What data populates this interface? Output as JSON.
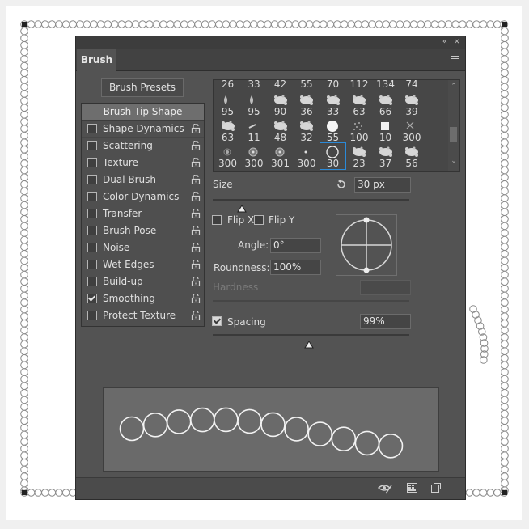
{
  "panel": {
    "collapse_icon": "double-chevron-left-icon",
    "close_icon": "close-icon",
    "tab_label": "Brush",
    "menu_icon": "panel-menu-icon"
  },
  "presets_button": "Brush Presets",
  "tip_shape_header": "Brush Tip Shape",
  "settings": [
    {
      "label": "Shape Dynamics",
      "checked": false
    },
    {
      "label": "Scattering",
      "checked": false
    },
    {
      "label": "Texture",
      "checked": false
    },
    {
      "label": "Dual Brush",
      "checked": false
    },
    {
      "label": "Color Dynamics",
      "checked": false
    },
    {
      "label": "Transfer",
      "checked": false
    },
    {
      "label": "Brush Pose",
      "checked": false
    },
    {
      "label": "Noise",
      "checked": false
    },
    {
      "label": "Wet Edges",
      "checked": false
    },
    {
      "label": "Build-up",
      "checked": false
    },
    {
      "label": "Smoothing",
      "checked": true
    },
    {
      "label": "Protect Texture",
      "checked": false
    }
  ],
  "tip_grid": {
    "top_row": [
      "26",
      "33",
      "42",
      "55",
      "70",
      "112",
      "134",
      "74"
    ],
    "rows": [
      [
        "95",
        "95",
        "90",
        "36",
        "33",
        "63",
        "66",
        "39"
      ],
      [
        "63",
        "11",
        "48",
        "32",
        "55",
        "100",
        "10",
        "300"
      ],
      [
        "300",
        "300",
        "301",
        "300",
        "30",
        "23",
        "37",
        "56"
      ]
    ],
    "selected": "30"
  },
  "size": {
    "label": "Size",
    "value": "30 px",
    "reset_icon": "reset-arrow-icon"
  },
  "flip_x": {
    "label": "Flip X",
    "checked": false
  },
  "flip_y": {
    "label": "Flip Y",
    "checked": false
  },
  "angle": {
    "label": "Angle:",
    "value": "0°"
  },
  "roundness": {
    "label": "Roundness:",
    "value": "100%"
  },
  "hardness": {
    "label": "Hardness",
    "value": ""
  },
  "spacing": {
    "label": "Spacing",
    "value": "99%",
    "checked": true
  },
  "bottom_icons": [
    "eye-toggle-icon",
    "grid-icon",
    "new-brush-icon"
  ]
}
